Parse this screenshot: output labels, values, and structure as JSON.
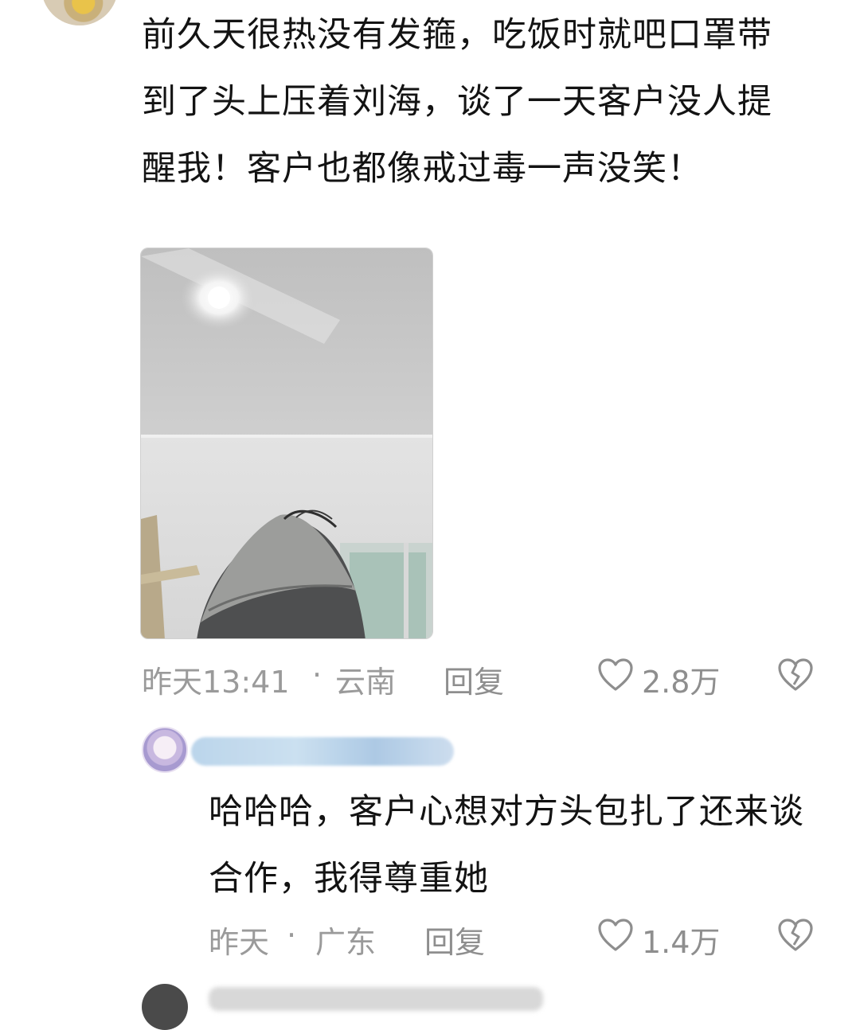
{
  "comment": {
    "text": "前久天很热没有发箍，吃饭时就吧口罩带到了头上压着刘海，谈了一天客户没人提醒我！客户也都像戒过毒一声没笑！",
    "time": "昨天13:41",
    "separator": "·",
    "location": "云南",
    "reply_label": "回复",
    "like_count": "2.8万",
    "icons": {
      "like": "heart-outline-icon",
      "dislike": "broken-heart-icon"
    }
  },
  "reply": {
    "text": "哈哈哈，客户心想对方头包扎了还来谈合作，我得尊重她",
    "time": "昨天",
    "separator": "·",
    "location": "广东",
    "reply_label": "回复",
    "like_count": "1.4万",
    "icons": {
      "like": "heart-outline-icon",
      "dislike": "broken-heart-icon"
    }
  },
  "colors": {
    "text": "#131313",
    "meta": "#9a9a9a",
    "background": "#ffffff"
  }
}
